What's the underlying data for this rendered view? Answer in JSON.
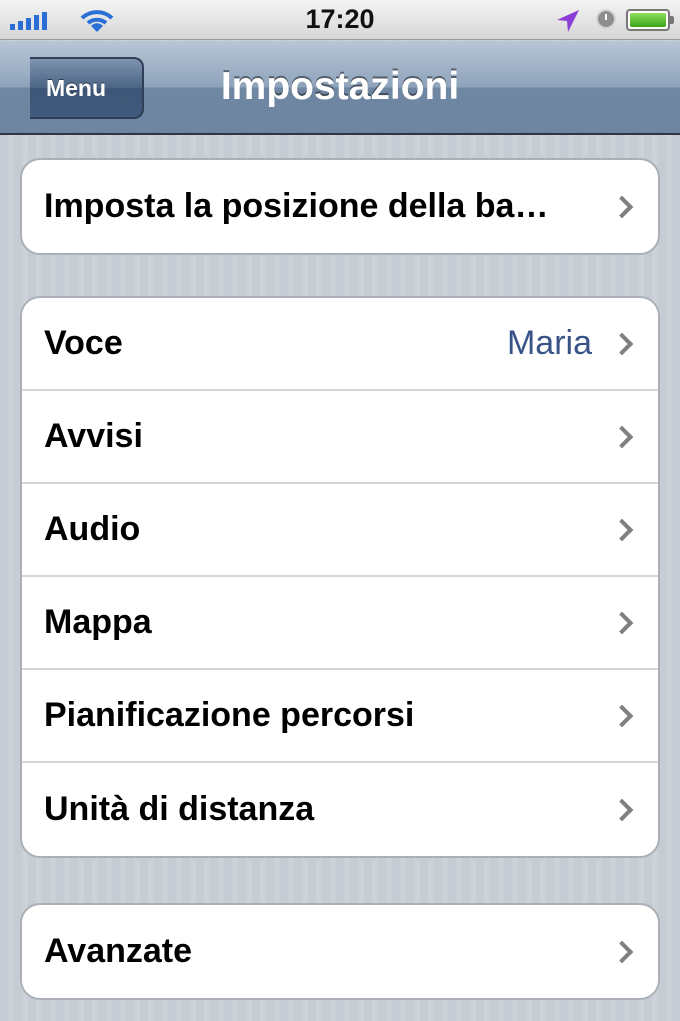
{
  "status_bar": {
    "time": "17:20",
    "signal_icon": "signal-bars-icon",
    "wifi_icon": "wifi-icon",
    "location_icon": "location-arrow-icon",
    "alarm_icon": "clock-icon",
    "battery_icon": "battery-icon",
    "battery_level": 1.0
  },
  "nav": {
    "back_label": "Menu",
    "title": "Impostazioni"
  },
  "groups": [
    {
      "rows": [
        {
          "label": "Imposta la posizione della ba…",
          "value": ""
        }
      ]
    },
    {
      "rows": [
        {
          "label": "Voce",
          "value": "Maria"
        },
        {
          "label": "Avvisi",
          "value": ""
        },
        {
          "label": "Audio",
          "value": ""
        },
        {
          "label": "Mappa",
          "value": ""
        },
        {
          "label": "Pianificazione percorsi",
          "value": ""
        },
        {
          "label": "Unità di distanza",
          "value": ""
        }
      ]
    },
    {
      "rows": [
        {
          "label": "Avanzate",
          "value": ""
        }
      ]
    }
  ],
  "colors": {
    "value_text": "#385487",
    "nav_bar": "#6f87a2",
    "background": "#c5ccd4"
  }
}
